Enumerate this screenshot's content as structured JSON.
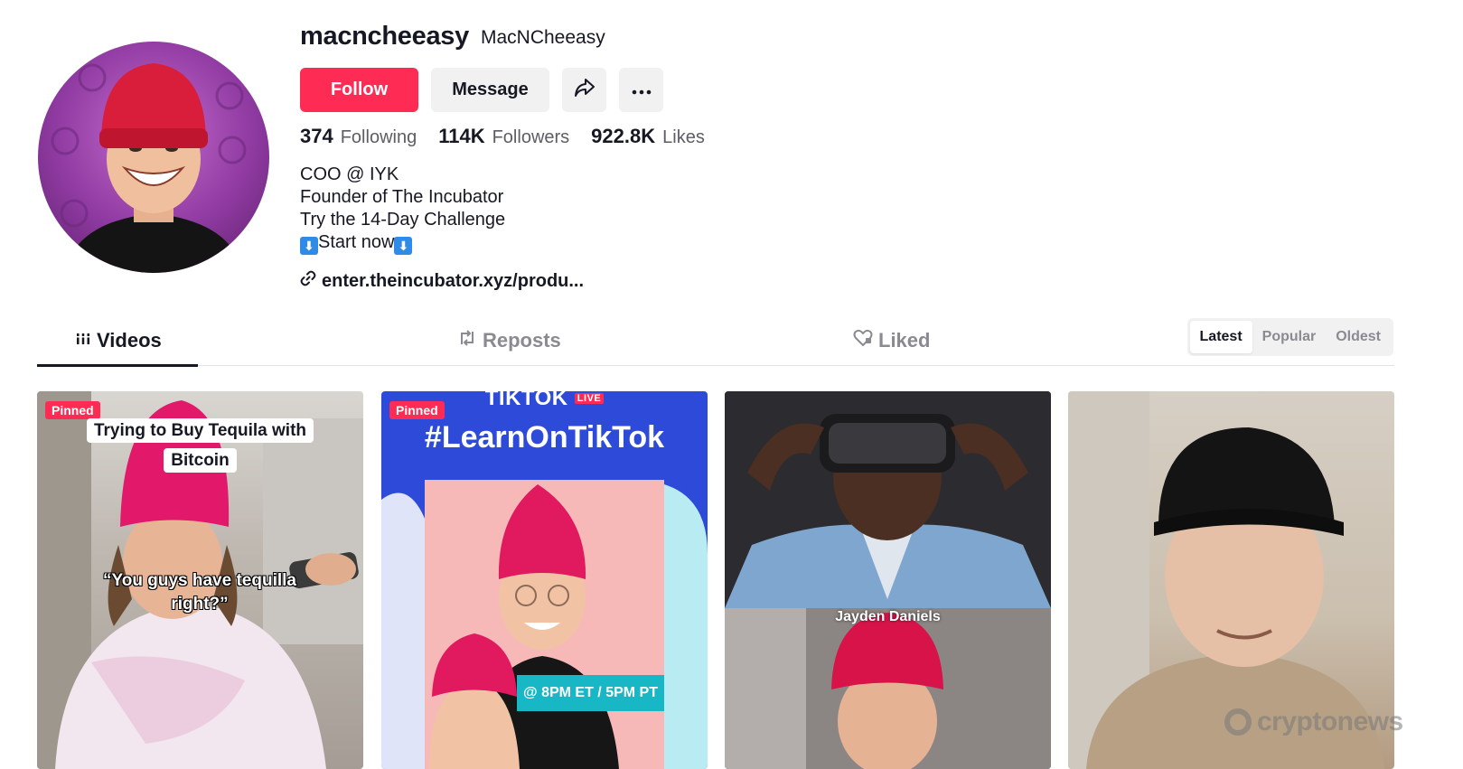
{
  "profile": {
    "username": "macncheeasy",
    "nickname": "MacNCheeasy",
    "avatar_icon": "profile-avatar",
    "buttons": {
      "follow": "Follow",
      "message": "Message",
      "share_icon": "share-icon",
      "more_icon": "more-icon"
    },
    "stats": {
      "following_count": "374",
      "following_label": "Following",
      "followers_count": "114K",
      "followers_label": "Followers",
      "likes_count": "922.8K",
      "likes_label": "Likes"
    },
    "bio": {
      "line1": "COO @ IYK",
      "line2": "Founder of The Incubator",
      "line3": "Try the 14-Day Challenge",
      "line4": "Start now",
      "arrow_glyph": "⬇"
    },
    "link": "enter.theincubator.xyz/produ..."
  },
  "tabs": {
    "videos": "Videos",
    "reposts": "Reposts",
    "liked": "Liked",
    "active": "Videos"
  },
  "sort": {
    "latest": "Latest",
    "popular": "Popular",
    "oldest": "Oldest",
    "active": "Latest"
  },
  "videos": [
    {
      "pinned_label": "Pinned",
      "caption_line1": "Trying to Buy Tequila with",
      "caption_line2": "Bitcoin",
      "overlay_quote": "“You guys have tequilla right?”"
    },
    {
      "pinned_label": "Pinned",
      "topline": "TIKTOK",
      "live_badge": "LIVE",
      "hashtag": "#LearnOnTikTok",
      "time_text": "@ 8PM ET / 5PM PT"
    },
    {
      "overlay_name": "Jayden Daniels"
    },
    {}
  ],
  "watermark": "cryptonews",
  "colors": {
    "accent": "#fe2c55",
    "text": "#161823",
    "muted": "#8a8b91",
    "button_bg": "#f1f1f2"
  }
}
